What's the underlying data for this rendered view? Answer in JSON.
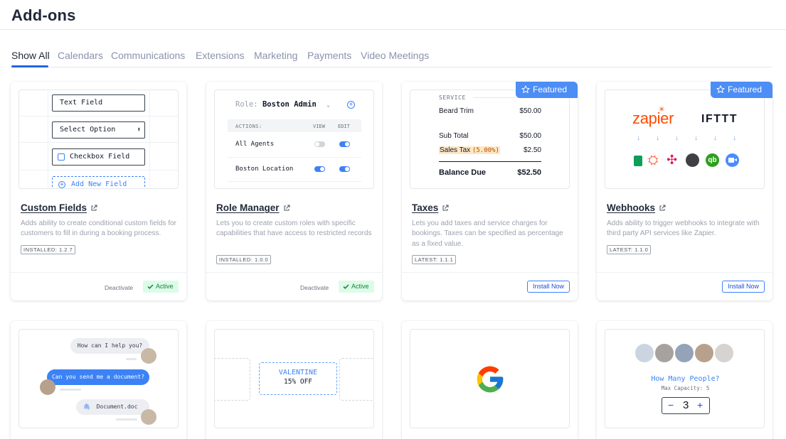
{
  "page": {
    "title": "Add-ons"
  },
  "tabs": [
    "Show All",
    "Calendars",
    "Communications",
    "Extensions",
    "Marketing",
    "Payments",
    "Video Meetings"
  ],
  "colors": {
    "accent": "#2563eb",
    "featured": "#4c8df6",
    "active_bg": "#dcfce7",
    "active_text": "#15803d"
  },
  "cards": [
    {
      "title": "Custom Fields",
      "description": "Adds ability to create conditional custom fields for customers to fill in during a booking process.",
      "version": "INSTALLED: 1.2.7",
      "deactivate": "Deactivate",
      "status": "Active",
      "preview": {
        "text_field": "Text Field",
        "select_option": "Select Option",
        "checkbox_field": "Checkbox Field",
        "add_new_field": "Add New Field"
      }
    },
    {
      "title": "Role Manager",
      "description": "Lets you to create custom roles with specific capabilities that have access to restricted records",
      "version": "INSTALLED: 1.0.0",
      "deactivate": "Deactivate",
      "status": "Active",
      "preview": {
        "role_label": "Role:",
        "role_value": "Boston Admin",
        "col_actions": "ACTIONS:",
        "col_view": "VIEW",
        "col_edit": "EDIT",
        "row1": "All Agents",
        "row2": "Boston Location"
      }
    },
    {
      "title": "Taxes",
      "description": "Lets you add taxes and service charges for bookings. Taxes can be specified as percentage as a fixed value.",
      "version": "LATEST: 1.1.1",
      "featured": "Featured",
      "install": "Install Now",
      "preview": {
        "service_label": "SERVICE",
        "item": "Beard Trim",
        "item_price": "$50.00",
        "subtotal_label": "Sub Total",
        "subtotal": "$50.00",
        "tax_label": "Sales Tax",
        "tax_rate": "(5.00%)",
        "tax": "$2.50",
        "balance_label": "Balance Due",
        "balance": "$52.50"
      }
    },
    {
      "title": "Webhooks",
      "description": "Adds ability to trigger webhooks to integrate with third party API services like Zapier.",
      "version": "LATEST: 1.1.0",
      "featured": "Featured",
      "install": "Install Now",
      "preview": {
        "zapier": "zapier",
        "ifttt": "IFTTT"
      }
    }
  ],
  "bottom_cards": {
    "chat": {
      "msg1": "How can I help you?",
      "msg2": "Can you send me a document?",
      "msg3": "Document.doc"
    },
    "coupon": {
      "code": "VALENTINE",
      "discount": "15% OFF"
    },
    "google": {},
    "people": {
      "question": "How Many People?",
      "capacity": "Max Capacity: 5",
      "minus": "−",
      "count": "3",
      "plus": "+"
    }
  }
}
